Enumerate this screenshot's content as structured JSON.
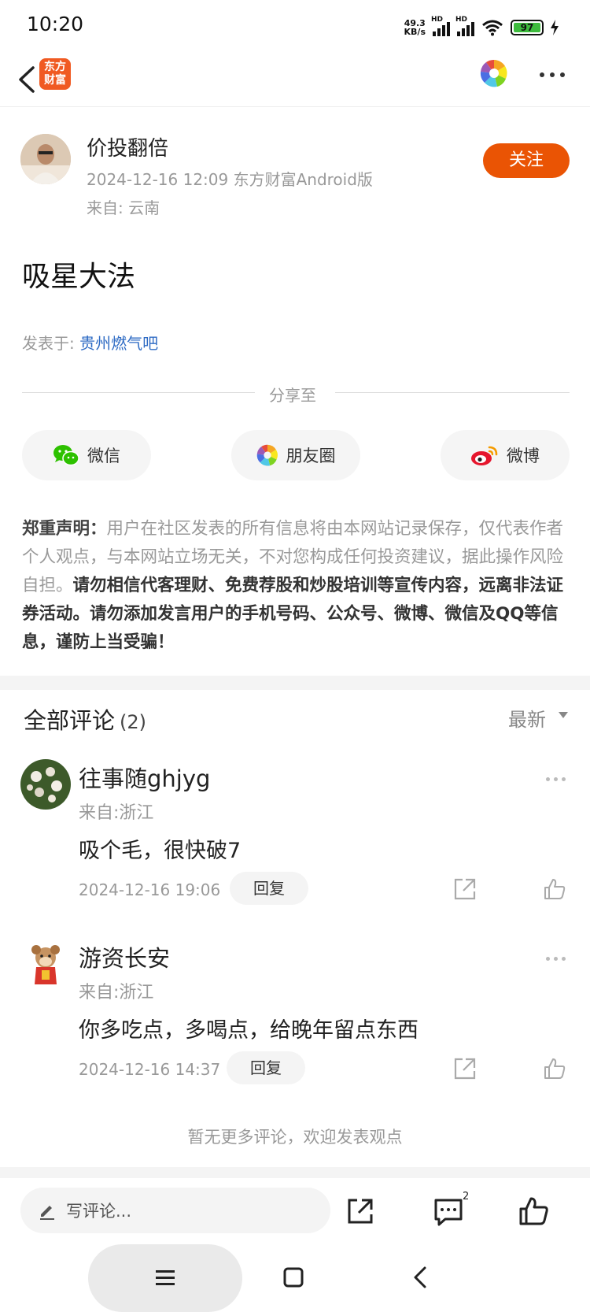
{
  "status_bar": {
    "time": "10:20",
    "net_speed_value": "49.3",
    "net_speed_unit": "KB/s",
    "signal_1_label": "HD",
    "signal_2_label": "HD",
    "battery": "97"
  },
  "nav": {
    "app_logo_line1": "东方",
    "app_logo_line2": "财富"
  },
  "author": {
    "name": "价投翻倍",
    "meta": "2024-12-16 12:09 东方财富Android版",
    "location": "来自: 云南",
    "follow_label": "关注"
  },
  "post": {
    "title": "吸星大法",
    "posted_in_label": "发表于: ",
    "posted_in_bar": "贵州燃气吧"
  },
  "share": {
    "label": "分享至",
    "wechat": "微信",
    "moments": "朋友圈",
    "weibo": "微博"
  },
  "disclaimer": {
    "heading": "郑重声明：",
    "text1": "用户在社区发表的所有信息将由本网站记录保存，仅代表作者个人观点，与本网站立场无关，不对您构成任何投资建议，据此操作风险自担。",
    "text2": "请勿相信代客理财、免费荐股和炒股培训等宣传内容，远离非法证券活动。请勿添加发言用户的手机号码、公众号、微博、微信及QQ等信息，谨防上当受骗！"
  },
  "comments": {
    "title": "全部评论",
    "count": "(2)",
    "sort_label": "最新",
    "items": [
      {
        "name": "往事随ghjyg",
        "location": "来自:浙江",
        "text": "吸个毛，很快破7",
        "time": "2024-12-16 19:06",
        "reply": "回复"
      },
      {
        "name": "游资长安",
        "location": "来自:浙江",
        "text": "你多吃点，多喝点，给晚年留点东西",
        "time": "2024-12-16 14:37",
        "reply": "回复"
      }
    ],
    "no_more": "暂无更多评论，欢迎发表观点"
  },
  "bottom_bar": {
    "write_placeholder": "写评论...",
    "comment_badge": "2"
  },
  "colors": {
    "accent": "#ea5404",
    "link": "#2e6bc4",
    "battery": "#3dbb3d"
  }
}
